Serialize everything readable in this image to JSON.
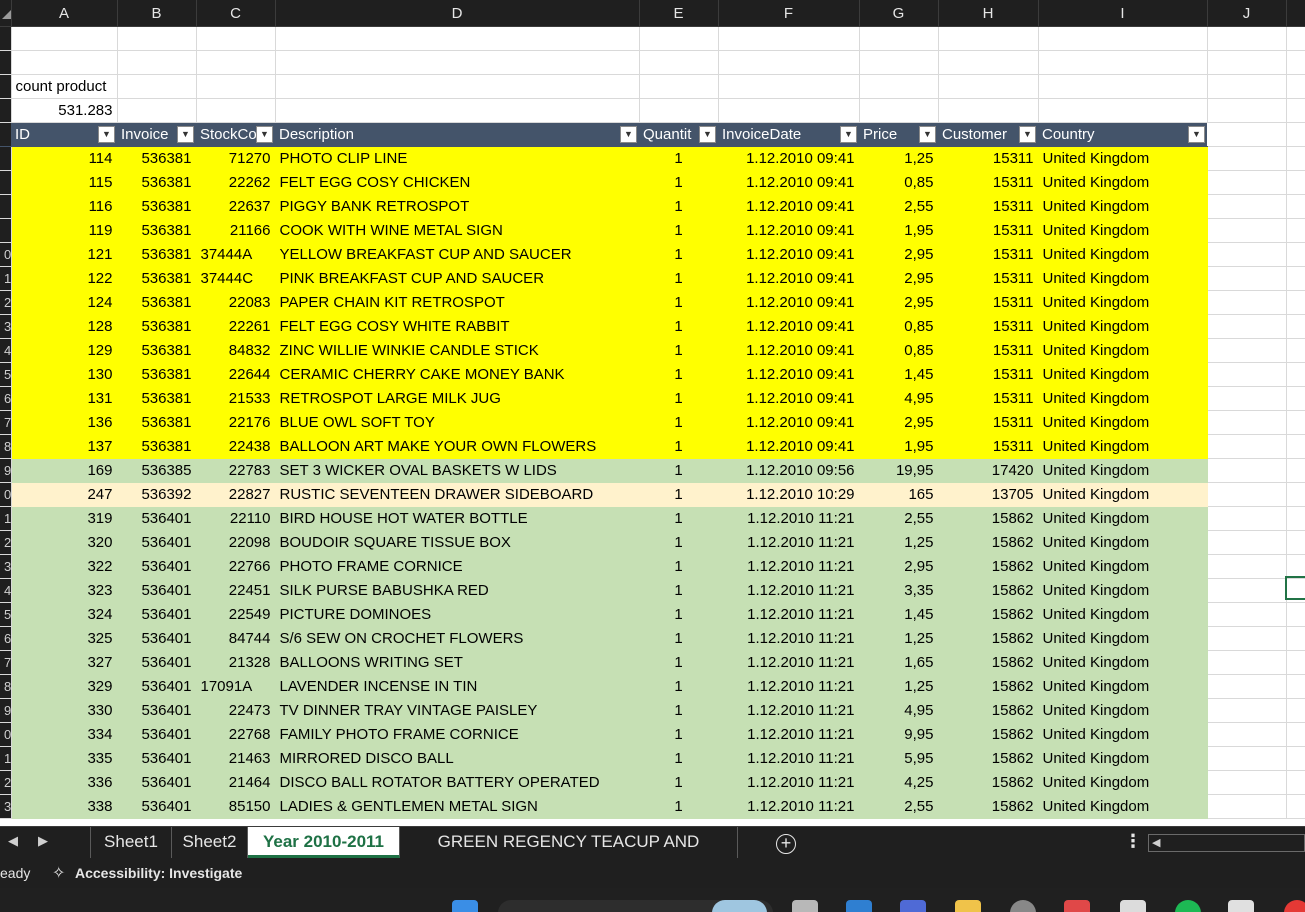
{
  "columns": [
    "A",
    "B",
    "C",
    "D",
    "E",
    "F",
    "G",
    "H",
    "I",
    "J"
  ],
  "summary": {
    "label": "count product",
    "value": "531.283"
  },
  "table": {
    "headers": [
      "ID",
      "Invoice",
      "StockCo",
      "Description",
      "Quantit",
      "InvoiceDate",
      "Price",
      "Customer",
      "Country"
    ]
  },
  "row_headers": [
    "",
    "",
    "",
    "",
    "",
    "",
    "",
    "",
    "",
    "0",
    "1",
    "2",
    "3",
    "4",
    "5",
    "6",
    "7",
    "8",
    "9",
    "0",
    "1",
    "2",
    "3",
    "4",
    "5",
    "6",
    "7",
    "8",
    "9",
    "0",
    "1",
    "2",
    "3"
  ],
  "rows": [
    {
      "fill": "yellow",
      "cells": [
        "114",
        "536381",
        "71270",
        "PHOTO CLIP LINE",
        "1",
        "1.12.2010 09:41",
        "1,25",
        "15311",
        "United Kingdom"
      ]
    },
    {
      "fill": "yellow",
      "cells": [
        "115",
        "536381",
        "22262",
        "FELT EGG COSY CHICKEN",
        "1",
        "1.12.2010 09:41",
        "0,85",
        "15311",
        "United Kingdom"
      ]
    },
    {
      "fill": "yellow",
      "cells": [
        "116",
        "536381",
        "22637",
        "PIGGY BANK RETROSPOT",
        "1",
        "1.12.2010 09:41",
        "2,55",
        "15311",
        "United Kingdom"
      ]
    },
    {
      "fill": "yellow",
      "cells": [
        "119",
        "536381",
        "21166",
        "COOK WITH WINE METAL SIGN",
        "1",
        "1.12.2010 09:41",
        "1,95",
        "15311",
        "United Kingdom"
      ]
    },
    {
      "fill": "yellow",
      "cells": [
        "121",
        "536381",
        "37444A",
        "YELLOW BREAKFAST CUP AND SAUCER",
        "1",
        "1.12.2010 09:41",
        "2,95",
        "15311",
        "United Kingdom"
      ]
    },
    {
      "fill": "yellow",
      "cells": [
        "122",
        "536381",
        "37444C",
        "PINK BREAKFAST CUP AND SAUCER",
        "1",
        "1.12.2010 09:41",
        "2,95",
        "15311",
        "United Kingdom"
      ]
    },
    {
      "fill": "yellow",
      "cells": [
        "124",
        "536381",
        "22083",
        "PAPER CHAIN KIT RETROSPOT",
        "1",
        "1.12.2010 09:41",
        "2,95",
        "15311",
        "United Kingdom"
      ]
    },
    {
      "fill": "yellow",
      "cells": [
        "128",
        "536381",
        "22261",
        "FELT EGG COSY WHITE RABBIT",
        "1",
        "1.12.2010 09:41",
        "0,85",
        "15311",
        "United Kingdom"
      ]
    },
    {
      "fill": "yellow",
      "cells": [
        "129",
        "536381",
        "84832",
        "ZINC WILLIE WINKIE  CANDLE STICK",
        "1",
        "1.12.2010 09:41",
        "0,85",
        "15311",
        "United Kingdom"
      ]
    },
    {
      "fill": "yellow",
      "cells": [
        "130",
        "536381",
        "22644",
        "CERAMIC CHERRY CAKE MONEY BANK",
        "1",
        "1.12.2010 09:41",
        "1,45",
        "15311",
        "United Kingdom"
      ]
    },
    {
      "fill": "yellow",
      "cells": [
        "131",
        "536381",
        "21533",
        "RETROSPOT LARGE MILK JUG",
        "1",
        "1.12.2010 09:41",
        "4,95",
        "15311",
        "United Kingdom"
      ]
    },
    {
      "fill": "yellow",
      "cells": [
        "136",
        "536381",
        "22176",
        "BLUE OWL SOFT TOY",
        "1",
        "1.12.2010 09:41",
        "2,95",
        "15311",
        "United Kingdom"
      ]
    },
    {
      "fill": "yellow",
      "cells": [
        "137",
        "536381",
        "22438",
        "BALLOON ART MAKE YOUR OWN FLOWERS",
        "1",
        "1.12.2010 09:41",
        "1,95",
        "15311",
        "United Kingdom"
      ]
    },
    {
      "fill": "green",
      "cells": [
        "169",
        "536385",
        "22783",
        "SET 3 WICKER OVAL BASKETS W LIDS",
        "1",
        "1.12.2010 09:56",
        "19,95",
        "17420",
        "United Kingdom"
      ]
    },
    {
      "fill": "peach",
      "cells": [
        "247",
        "536392",
        "22827",
        "RUSTIC  SEVENTEEN DRAWER SIDEBOARD",
        "1",
        "1.12.2010 10:29",
        "165",
        "13705",
        "United Kingdom"
      ]
    },
    {
      "fill": "green",
      "cells": [
        "319",
        "536401",
        "22110",
        "BIRD HOUSE HOT WATER BOTTLE",
        "1",
        "1.12.2010 11:21",
        "2,55",
        "15862",
        "United Kingdom"
      ]
    },
    {
      "fill": "green",
      "cells": [
        "320",
        "536401",
        "22098",
        "BOUDOIR SQUARE TISSUE BOX",
        "1",
        "1.12.2010 11:21",
        "1,25",
        "15862",
        "United Kingdom"
      ]
    },
    {
      "fill": "green",
      "cells": [
        "322",
        "536401",
        "22766",
        "PHOTO FRAME CORNICE",
        "1",
        "1.12.2010 11:21",
        "2,95",
        "15862",
        "United Kingdom"
      ]
    },
    {
      "fill": "green",
      "cells": [
        "323",
        "536401",
        "22451",
        "SILK PURSE BABUSHKA RED",
        "1",
        "1.12.2010 11:21",
        "3,35",
        "15862",
        "United Kingdom"
      ]
    },
    {
      "fill": "green",
      "cells": [
        "324",
        "536401",
        "22549",
        "PICTURE DOMINOES",
        "1",
        "1.12.2010 11:21",
        "1,45",
        "15862",
        "United Kingdom"
      ]
    },
    {
      "fill": "green",
      "cells": [
        "325",
        "536401",
        "84744",
        "S/6 SEW ON CROCHET FLOWERS",
        "1",
        "1.12.2010 11:21",
        "1,25",
        "15862",
        "United Kingdom"
      ]
    },
    {
      "fill": "green",
      "cells": [
        "327",
        "536401",
        "21328",
        "BALLOONS  WRITING SET",
        "1",
        "1.12.2010 11:21",
        "1,65",
        "15862",
        "United Kingdom"
      ]
    },
    {
      "fill": "green",
      "cells": [
        "329",
        "536401",
        "17091A",
        "LAVENDER INCENSE IN TIN",
        "1",
        "1.12.2010 11:21",
        "1,25",
        "15862",
        "United Kingdom"
      ]
    },
    {
      "fill": "green",
      "cells": [
        "330",
        "536401",
        "22473",
        "TV DINNER TRAY VINTAGE PAISLEY",
        "1",
        "1.12.2010 11:21",
        "4,95",
        "15862",
        "United Kingdom"
      ]
    },
    {
      "fill": "green",
      "cells": [
        "334",
        "536401",
        "22768",
        "FAMILY PHOTO FRAME CORNICE",
        "1",
        "1.12.2010 11:21",
        "9,95",
        "15862",
        "United Kingdom"
      ]
    },
    {
      "fill": "green",
      "cells": [
        "335",
        "536401",
        "21463",
        "MIRRORED DISCO BALL",
        "1",
        "1.12.2010 11:21",
        "5,95",
        "15862",
        "United Kingdom"
      ]
    },
    {
      "fill": "green",
      "cells": [
        "336",
        "536401",
        "21464",
        "DISCO BALL ROTATOR BATTERY OPERATED",
        "1",
        "1.12.2010 11:21",
        "4,25",
        "15862",
        "United Kingdom"
      ]
    },
    {
      "fill": "green",
      "cells": [
        "338",
        "536401",
        "85150",
        "LADIES & GENTLEMEN METAL SIGN",
        "1",
        "1.12.2010 11:21",
        "2,55",
        "15862",
        "United Kingdom"
      ]
    }
  ],
  "sheet_tabs": [
    "Sheet1",
    "Sheet2",
    "Year 2010-2011",
    "GREEN REGENCY TEACUP AND SAUCER"
  ],
  "active_tab": "Year 2010-2011",
  "status": {
    "ready": "eady",
    "accessibility": "Accessibility: Investigate"
  },
  "colors": {
    "yellow": "#ffff00",
    "green": "#c6e0b4",
    "peach": "#fff2cc",
    "table_header": "#44546a",
    "excel_green": "#1e7145"
  }
}
